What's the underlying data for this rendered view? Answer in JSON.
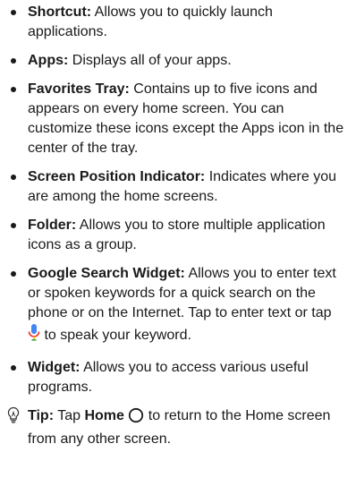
{
  "items": [
    {
      "term": "Shortcut:",
      "desc": " Allows you to quickly launch applications."
    },
    {
      "term": "Apps:",
      "desc": " Displays all of your apps."
    },
    {
      "term": "Favorites Tray:",
      "desc": " Contains up to five icons and appears on every home screen. You can customize these icons except the Apps icon in the center of the tray."
    },
    {
      "term": "Screen Position Indicator:",
      "desc": " Indicates where you are among the home screens."
    },
    {
      "term": "Folder:",
      "desc": " Allows you to store multiple application icons as a group."
    },
    {
      "term": "Google Search Widget:",
      "desc_before_icon": " Allows you to enter text or spoken keywords for a quick search on the phone or on the Internet. Tap to enter text or tap ",
      "desc_after_icon": " to speak your keyword."
    },
    {
      "term": "Widget:",
      "desc": " Allows you to access various useful programs."
    }
  ],
  "tip": {
    "label": "Tip:",
    "text_before": " Tap ",
    "home_label": "Home",
    "text_after": " to return to the Home screen from any other screen."
  },
  "icons": {
    "mic": "microphone-icon",
    "home": "home-circle-icon",
    "tip": "lightbulb-icon"
  },
  "colors": {
    "mic_blue": "#4285F4",
    "mic_red": "#EA4335",
    "mic_yellow": "#FBBC05",
    "mic_green": "#34A853"
  }
}
